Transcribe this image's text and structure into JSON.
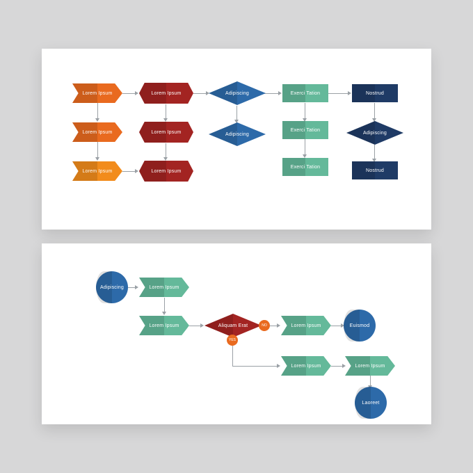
{
  "top": {
    "col1": [
      "Lorem Ipsum",
      "Lorem Ipsum",
      "Lorem Ipsum"
    ],
    "col2": [
      "Lorem Ipsum",
      "Lorem Ipsum",
      "Lorem Ipsum"
    ],
    "col3": [
      "Adipiscing",
      "Adipiscing"
    ],
    "col4": [
      "Exerci Tation",
      "Exerci Tation",
      "Exerci Tation"
    ],
    "col5": [
      "Nostrud",
      "Adipiscing",
      "Nostrud"
    ]
  },
  "bot": {
    "start": "Adipiscing",
    "g1": "Lorem Ipsum",
    "g2": "Lorem Ipsum",
    "decision": "Aliquam Erat",
    "yes": "YES",
    "no": "NO",
    "g3": "Lorem Ipsum",
    "c1": "Euismod",
    "g4": "Lorem Ipsum",
    "g5": "Lorem Ipsum",
    "c2": "Laoreet"
  },
  "colors": {
    "orange": "#e96a1f",
    "orangeLight": "#f28c1c",
    "red": "#a32422",
    "blue": "#2d6aa9",
    "navy": "#1f3b66",
    "green": "#64b99a",
    "line": "#9aa0a5"
  }
}
